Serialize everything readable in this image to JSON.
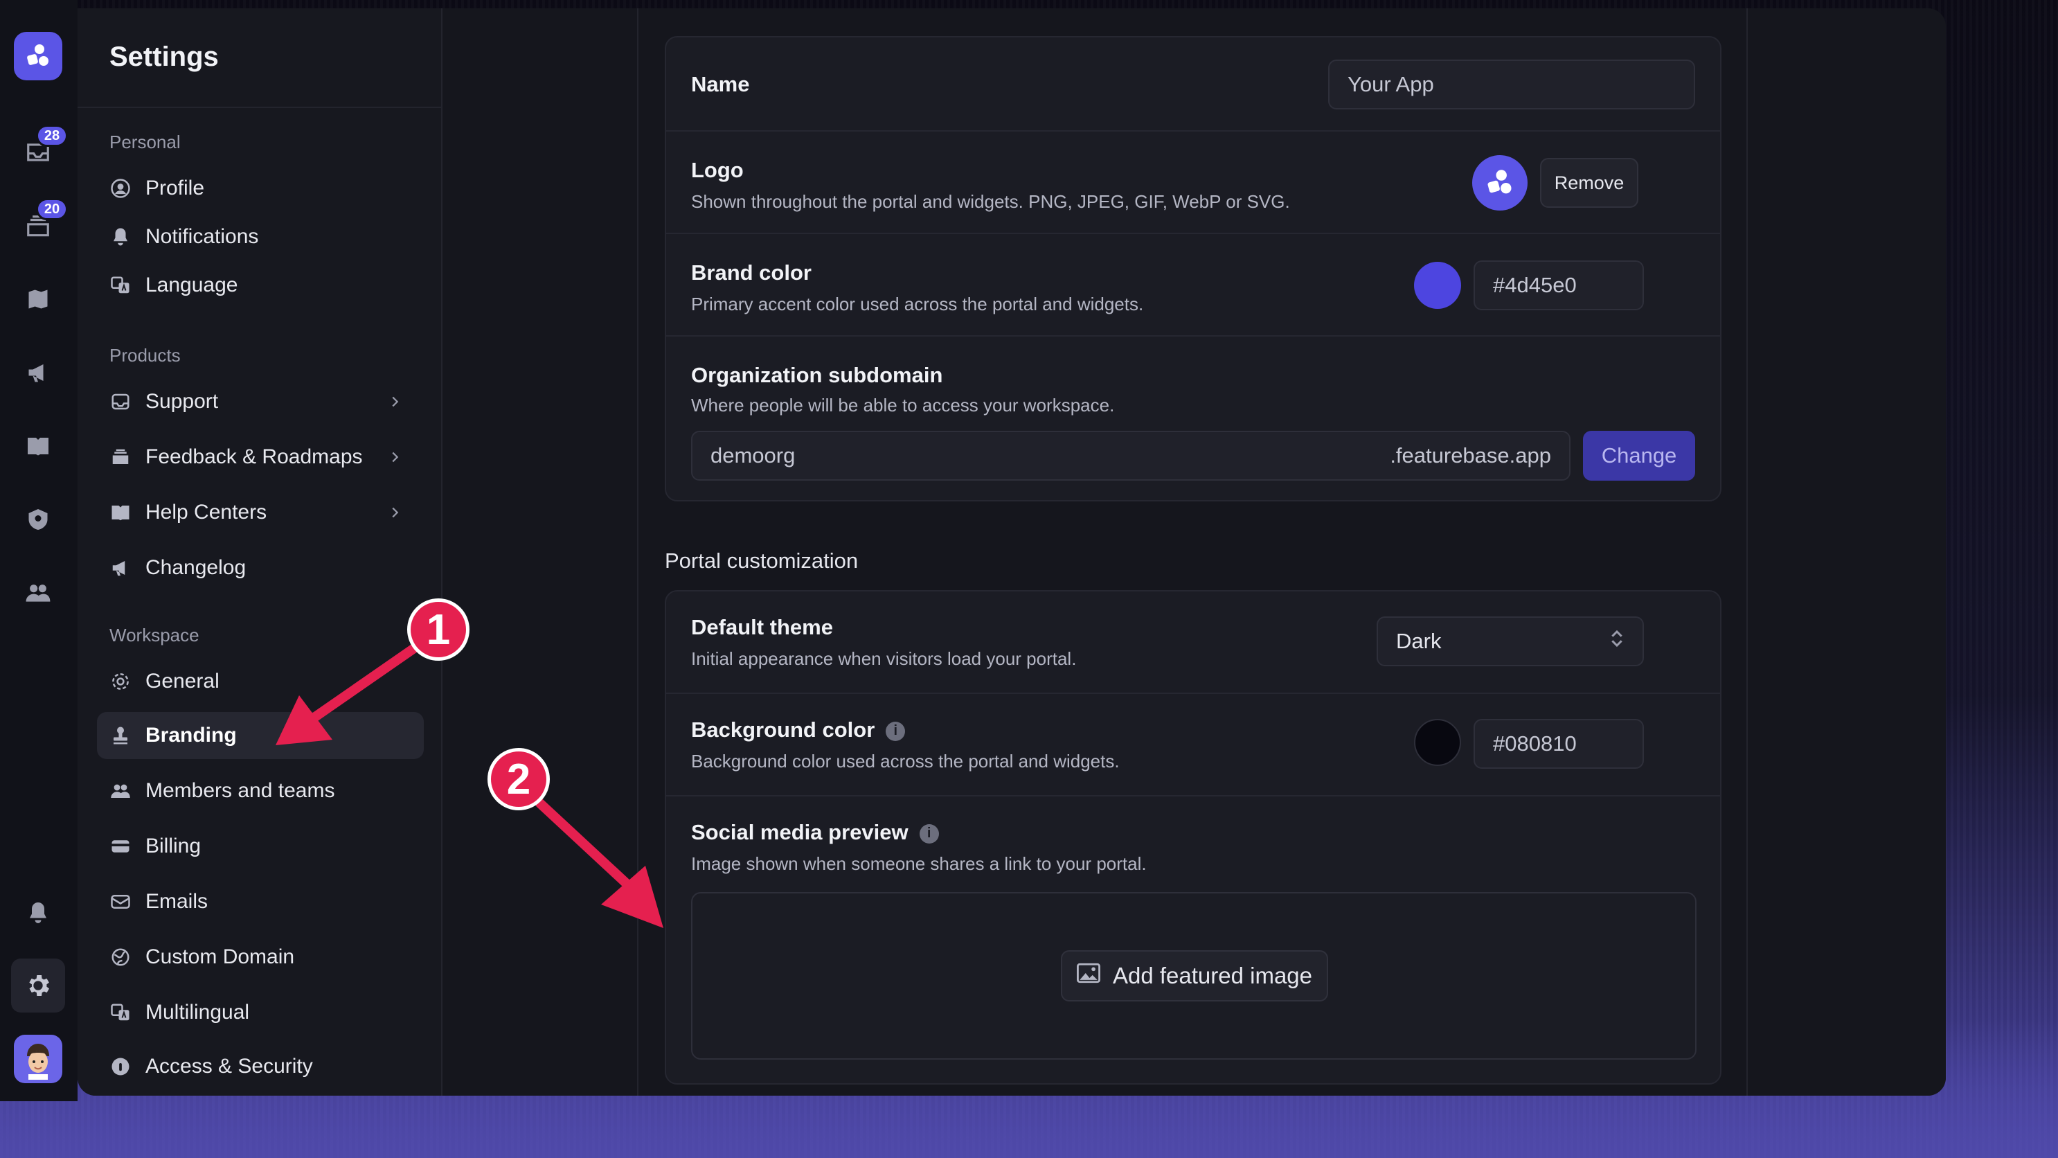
{
  "rail": {
    "badges": [
      "28",
      "20"
    ],
    "icons": [
      "app-logo-icon",
      "inbox-icon",
      "tray-icon",
      "map-icon",
      "megaphone-icon",
      "book-icon",
      "shield-icon",
      "users-icon",
      "bell-icon",
      "gear-icon",
      "avatar-icon"
    ]
  },
  "nav": {
    "title": "Settings",
    "sections": {
      "personal": "Personal",
      "products": "Products",
      "workspace": "Workspace"
    },
    "items": {
      "profile": "Profile",
      "notifications": "Notifications",
      "language": "Language",
      "support": "Support",
      "feedback": "Feedback & Roadmaps",
      "help_centers": "Help Centers",
      "changelog": "Changelog",
      "general": "General",
      "branding": "Branding",
      "members": "Members and teams",
      "billing": "Billing",
      "emails": "Emails",
      "custom_domain": "Custom Domain",
      "multilingual": "Multilingual",
      "access_security": "Access & Security"
    },
    "active": "branding"
  },
  "general": {
    "name_label": "Name",
    "name_placeholder": "Your App",
    "logo_label": "Logo",
    "logo_desc": "Shown throughout the portal and widgets. PNG, JPEG, GIF, WebP or SVG.",
    "logo_remove": "Remove",
    "brand_label": "Brand color",
    "brand_desc": "Primary accent color used across the portal and widgets.",
    "brand_value": "#4d45e0",
    "subdomain_label": "Organization subdomain",
    "subdomain_desc": "Where people will be able to access your workspace.",
    "subdomain_value": "demoorg",
    "subdomain_suffix": ".featurebase.app",
    "subdomain_change": "Change"
  },
  "portal": {
    "heading": "Portal customization",
    "theme_label": "Default theme",
    "theme_desc": "Initial appearance when visitors load your portal.",
    "theme_value": "Dark",
    "bg_label": "Background color",
    "bg_desc": "Background color used across the portal and widgets.",
    "bg_value": "#080810",
    "social_label": "Social media preview",
    "social_desc": "Image shown when someone shares a link to your portal.",
    "add_image": "Add featured image"
  },
  "annotations": [
    "1",
    "2"
  ],
  "colors": {
    "accent": "#5b55e6",
    "brand_swatch": "#4d45e0",
    "bg_swatch": "#080810",
    "annotation": "#e5204f"
  }
}
